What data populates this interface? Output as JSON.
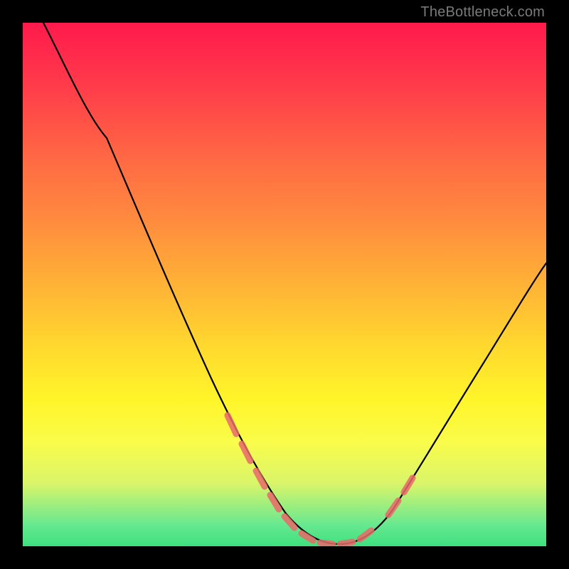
{
  "watermark": {
    "text": "TheBottleneck.com"
  },
  "colors": {
    "background": "#000000",
    "gradient_top": "#ff1a4d",
    "gradient_bottom": "#3ee07f",
    "curve": "#000000",
    "marker": "#e96a6a",
    "watermark_text": "#7a7a7a"
  },
  "chart_data": {
    "type": "line",
    "title": "",
    "xlabel": "",
    "ylabel": "",
    "xlim": [
      0,
      100
    ],
    "ylim": [
      0,
      100
    ],
    "grid": false,
    "legend": false,
    "series": [
      {
        "name": "bottleneck-curve",
        "x": [
          4,
          10,
          16,
          22,
          28,
          34,
          40,
          44,
          48,
          52,
          56,
          60,
          64,
          68,
          74,
          80,
          88,
          96,
          100
        ],
        "values": [
          100,
          90,
          78,
          66,
          54,
          42,
          30,
          22,
          14,
          8,
          3,
          1,
          1,
          3,
          9,
          18,
          30,
          42,
          48
        ]
      }
    ],
    "markers": [
      {
        "name": "highlighted-points",
        "x": [
          40,
          44,
          48,
          52,
          56,
          60,
          64,
          68,
          74
        ],
        "values": [
          30,
          22,
          14,
          8,
          3,
          1,
          1,
          3,
          9
        ]
      }
    ]
  }
}
